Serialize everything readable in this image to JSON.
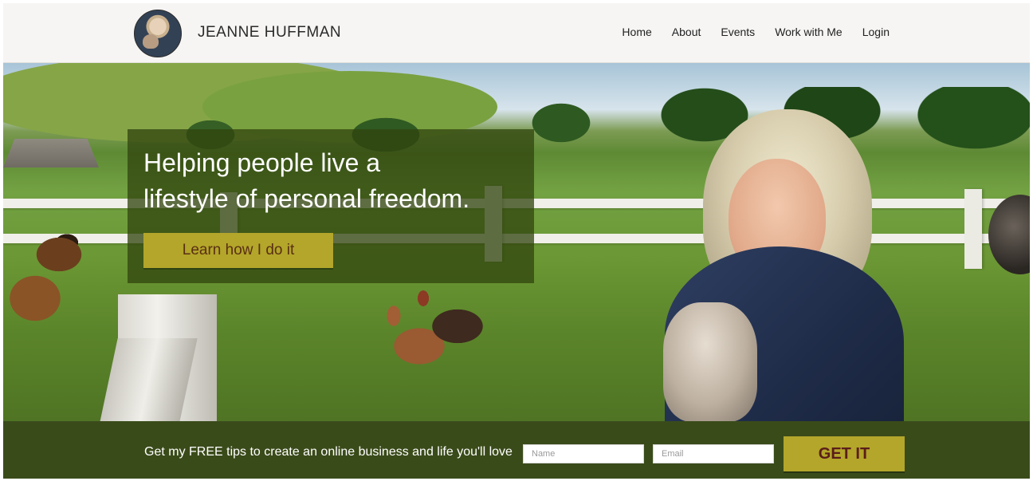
{
  "header": {
    "brand": "JEANNE HUFFMAN",
    "nav": [
      "Home",
      "About",
      "Events",
      "Work with Me",
      "Login"
    ]
  },
  "hero": {
    "headline": "Helping people live a\nlifestyle of personal freedom.",
    "cta_label": "Learn how I do it"
  },
  "signup": {
    "text": "Get my FREE tips to create an online business and life you'll love",
    "name_placeholder": "Name",
    "email_placeholder": "Email",
    "submit_label": "GET IT"
  },
  "colors": {
    "header_bg": "#f6f5f3",
    "signup_bg": "#3a4b1a",
    "button_gold": "#b3a62a",
    "hero_overlay": "#31450e"
  },
  "icons": [
    "avatar-photo"
  ]
}
